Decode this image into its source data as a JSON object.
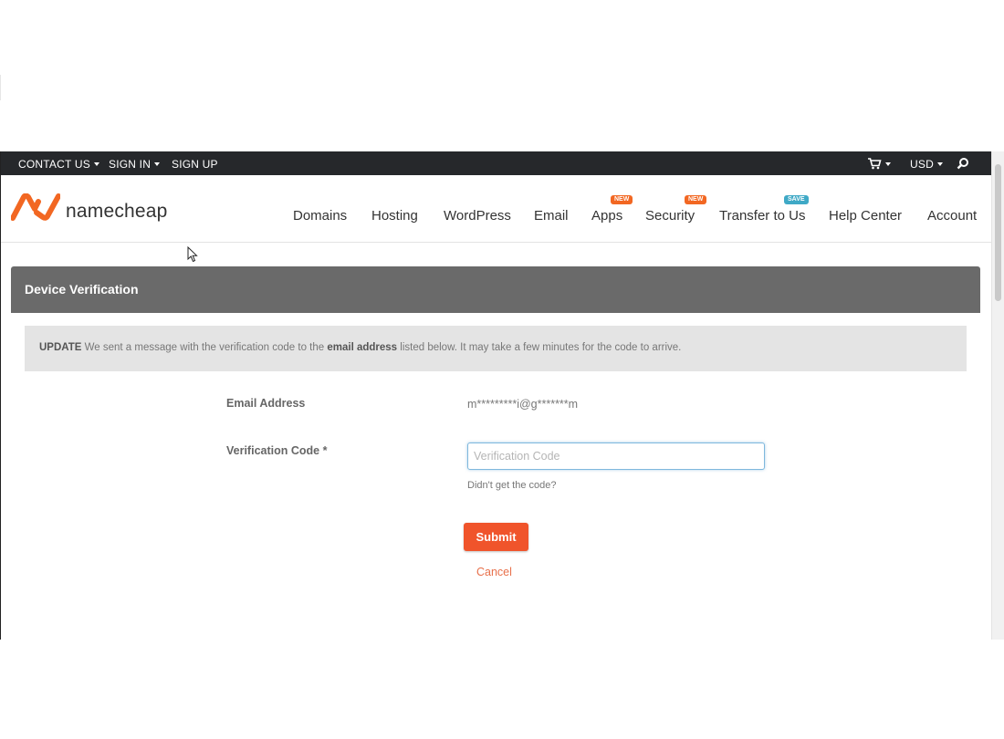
{
  "topbar": {
    "links": [
      {
        "label": "CONTACT US",
        "has_caret": true
      },
      {
        "label": "SIGN IN",
        "has_caret": true
      },
      {
        "label": "SIGN UP",
        "has_caret": false
      }
    ],
    "cart_icon": "cart-icon",
    "currency": "USD",
    "search_icon": "search-icon"
  },
  "brand": {
    "logo_text": "namecheap",
    "accent": "#f26722"
  },
  "nav": {
    "items": [
      {
        "label": "Domains"
      },
      {
        "label": "Hosting"
      },
      {
        "label": "WordPress"
      },
      {
        "label": "Email"
      },
      {
        "label": "Apps",
        "badge": "NEW"
      },
      {
        "label": "Security",
        "badge": "NEW"
      },
      {
        "label": "Transfer to Us",
        "badge": "SAVE"
      },
      {
        "label": "Help Center"
      },
      {
        "label": "Account"
      }
    ]
  },
  "panel": {
    "title": "Device Verification"
  },
  "notice": {
    "prefix": "UPDATE",
    "text_1": "We sent a message with the verification code to the",
    "bold": "email address",
    "text_2": "listed below. It may take a few minutes for the code to arrive."
  },
  "form": {
    "email_label": "Email Address",
    "email_value": "m*********i@g*******m",
    "code_label": "Verification Code *",
    "code_placeholder": "Verification Code",
    "code_value": "",
    "help_link": "Didn't get the code?",
    "submit_label": "Submit",
    "cancel_label": "Cancel",
    "submit_color": "#f0542b"
  }
}
